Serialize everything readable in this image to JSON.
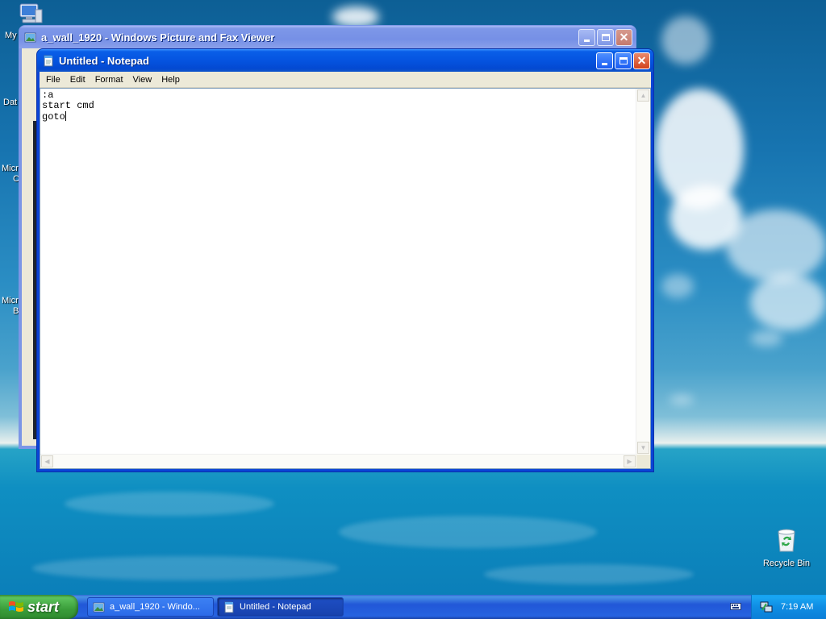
{
  "desktop": {
    "icons": [
      {
        "label": "My",
        "icon": "my-computer-icon"
      },
      {
        "label": "Dat",
        "icon": "partial-icon"
      },
      {
        "label": "Micro",
        "label2": "C",
        "icon": "partial-icon"
      },
      {
        "label": "Micro",
        "label2": "B",
        "icon": "partial-icon"
      }
    ],
    "recycle_bin": {
      "label": "Recycle Bin",
      "icon": "recycle-bin-icon"
    }
  },
  "picture_viewer": {
    "title": "a_wall_1920 - Windows Picture and Fax Viewer",
    "icon": "picture-viewer-icon"
  },
  "notepad": {
    "title": "Untitled - Notepad",
    "icon": "notepad-icon",
    "menu": [
      "File",
      "Edit",
      "Format",
      "View",
      "Help"
    ],
    "lines": [
      ":a",
      "start cmd",
      "goto"
    ]
  },
  "taskbar": {
    "start_label": "start",
    "items": [
      {
        "label": "a_wall_1920 - Windo...",
        "icon": "picture-viewer-icon"
      },
      {
        "label": "Untitled - Notepad",
        "icon": "notepad-icon"
      }
    ],
    "clock": "7:19 AM",
    "tray_icons": [
      "keyboard-icon",
      "network-icon"
    ]
  },
  "colors": {
    "title_active": "#0554e0",
    "title_inactive": "#7690e6",
    "start_green": "#3a9d3a",
    "taskbar_blue": "#2157d7"
  }
}
